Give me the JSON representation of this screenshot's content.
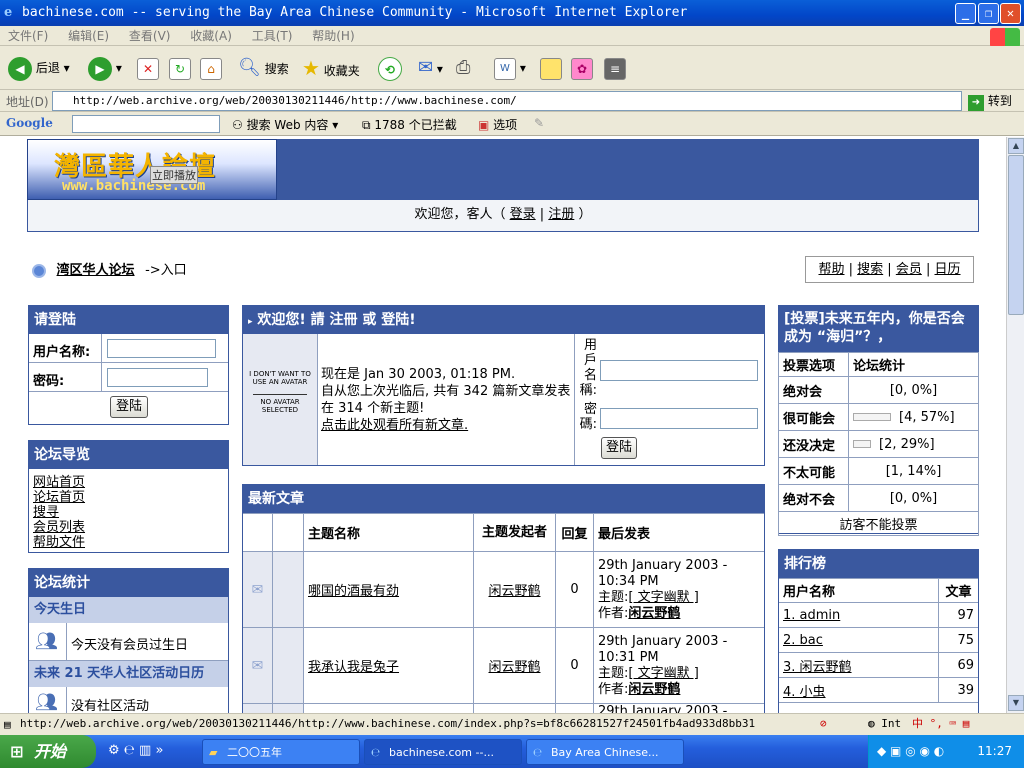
{
  "window": {
    "title": "bachinese.com -- serving the Bay Area Chinese Community - Microsoft Internet Explorer"
  },
  "menu": [
    "文件(F)",
    "编辑(E)",
    "查看(V)",
    "收藏(A)",
    "工具(T)",
    "帮助(H)"
  ],
  "toolbar": {
    "back": "后退",
    "search": "搜索",
    "favorites": "收藏夹"
  },
  "address": {
    "label": "地址(D)",
    "url": "http://web.archive.org/web/20030130211446/http://www.bachinese.com/",
    "go": "转到"
  },
  "googlebar": {
    "brand": "Google",
    "search_web": "搜索 Web 内容",
    "blocked": "1788 个已拦截",
    "options": "选项"
  },
  "site": {
    "logo_title": "灣區華人論壇",
    "logo_url": "www.bachinese.com",
    "logo_tag": "立即播放",
    "welcome_prefix": "欢迎您，客人（",
    "login": "登录",
    "sep": "|",
    "register": "注册",
    "welcome_suffix": "）"
  },
  "crumb": {
    "home": "湾区华人论坛",
    "current": "->入口"
  },
  "toplinks": [
    "帮助",
    "搜索",
    "会员",
    "日历"
  ],
  "login_box": {
    "title": "请登陆",
    "user_label": "用户名称:",
    "pass_label": "密码:",
    "button": "登陆"
  },
  "nav_box": {
    "title": "论坛导览",
    "links": [
      "网站首页",
      "论坛首页",
      "搜寻",
      "会员列表",
      "帮助文件"
    ]
  },
  "stats_box": {
    "title": "论坛统计",
    "birthday_head": "今天生日",
    "birthday_text": "今天没有会员过生日",
    "events_head": "未来 21 天华人社区活动日历",
    "events_text": "没有社区活动"
  },
  "welcome_box": {
    "title": "欢迎您! 請 注冊 或 登陆!",
    "avatar_top": "I DON'T WANT TO USE AN AVATAR",
    "avatar_bottom": "NO AVATAR SELECTED",
    "now": "现在是 Jan 30 2003, 01:18 PM.",
    "since": "自从您上次光临后, 共有 342 篇新文章发表在 314 个新主题!",
    "link": "点击此处观看所有新文章.",
    "user_label": "用戶名稱:",
    "pass_label": "密碼:",
    "button": "登陆"
  },
  "latest": {
    "title": "最新文章",
    "headers": [
      "主题名称",
      "主题发起者",
      "回复",
      "最后发表"
    ],
    "rows": [
      {
        "topic": "哪国的酒最有劲",
        "author": "闲云野鹤",
        "replies": "0",
        "date": "29th January 2003 - 10:34 PM",
        "subject_label": "主题:",
        "subject": "[ 文字幽默 ]",
        "by_label": "作者:",
        "by": "闲云野鹤"
      },
      {
        "topic": "我承认我是兔子",
        "author": "闲云野鹤",
        "replies": "0",
        "date": "29th January 2003 - 10:31 PM",
        "subject_label": "主题:",
        "subject": "[ 文字幽默 ]",
        "by_label": "作者:",
        "by": "闲云野鹤"
      },
      {
        "date": "29th January 2003 -"
      }
    ]
  },
  "poll": {
    "title": "[投票]未来五年内，你是否会成为 “海归”？，",
    "col1": "投票选项",
    "col2": "论坛统计",
    "options": [
      {
        "label": "绝对会",
        "result": "[0, 0%]",
        "pct": 0
      },
      {
        "label": "很可能会",
        "result": "[4, 57%]",
        "pct": 57
      },
      {
        "label": "还没决定",
        "result": "[2, 29%]",
        "pct": 29
      },
      {
        "label": "不太可能",
        "result": "[1, 14%]",
        "pct": 14
      },
      {
        "label": "绝对不会",
        "result": "[0, 0%]",
        "pct": 0
      }
    ],
    "footer": "訪客不能投票"
  },
  "ranking": {
    "title": "排行榜",
    "col1": "用户名称",
    "col2": "文章",
    "rows": [
      {
        "name": "1. admin",
        "count": "97"
      },
      {
        "name": "2. bac",
        "count": "75"
      },
      {
        "name": "3. 闲云野鹤",
        "count": "69"
      },
      {
        "name": "4. 小虫",
        "count": "39"
      }
    ]
  },
  "status": {
    "url": "http://web.archive.org/web/20030130211446/http://www.bachinese.com/index.php?s=bf8c66281527f24501fb4ad933d8bb31",
    "zone": "Int"
  },
  "taskbar": {
    "start": "开始",
    "tasks": [
      "二〇〇五年",
      "bachinese.com --...",
      "Bay Area Chinese..."
    ],
    "clock": "11:27"
  }
}
